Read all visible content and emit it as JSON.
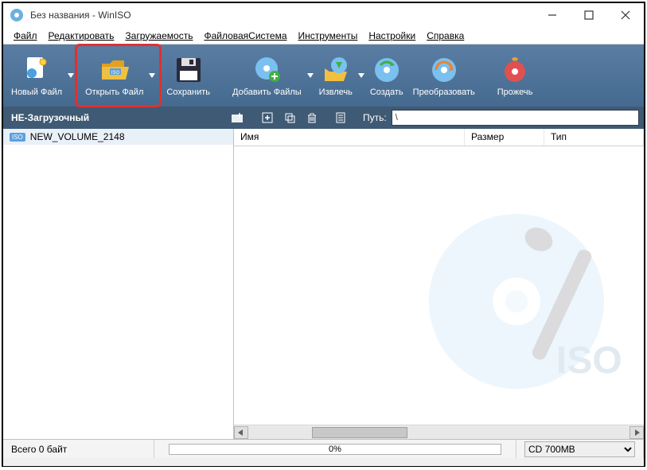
{
  "title": "Без названия - WinISO",
  "menus": {
    "file": "Файл",
    "edit": "Редактировать",
    "boot": "Загружаемость",
    "fs": "ФайловаяСистема",
    "tools": "Инструменты",
    "settings": "Настройки",
    "help": "Справка"
  },
  "toolbar": {
    "new_file": "Новый Файл",
    "open_file": "Открыть Файл",
    "save": "Сохранить",
    "add_files": "Добавить Файлы",
    "extract": "Извлечь",
    "create": "Создать",
    "convert": "Преобразовать",
    "burn": "Прожечь"
  },
  "subbar": {
    "boot_label": "НЕ-Загрузочный",
    "path_label": "Путь:",
    "path_value": "\\"
  },
  "tree": {
    "items": [
      {
        "label": "NEW_VOLUME_2148",
        "icon": "iso"
      }
    ]
  },
  "columns": {
    "name": "Имя",
    "size": "Размер",
    "type": "Тип"
  },
  "status": {
    "total": "Всего 0 байт",
    "progress_pct": "0%",
    "disc_type": "CD 700MB"
  },
  "colors": {
    "toolbar_grad_top": "#5a7da3",
    "toolbar_grad_bot": "#456a8f",
    "subbar": "#3f5a74",
    "highlight": "#e03030"
  }
}
